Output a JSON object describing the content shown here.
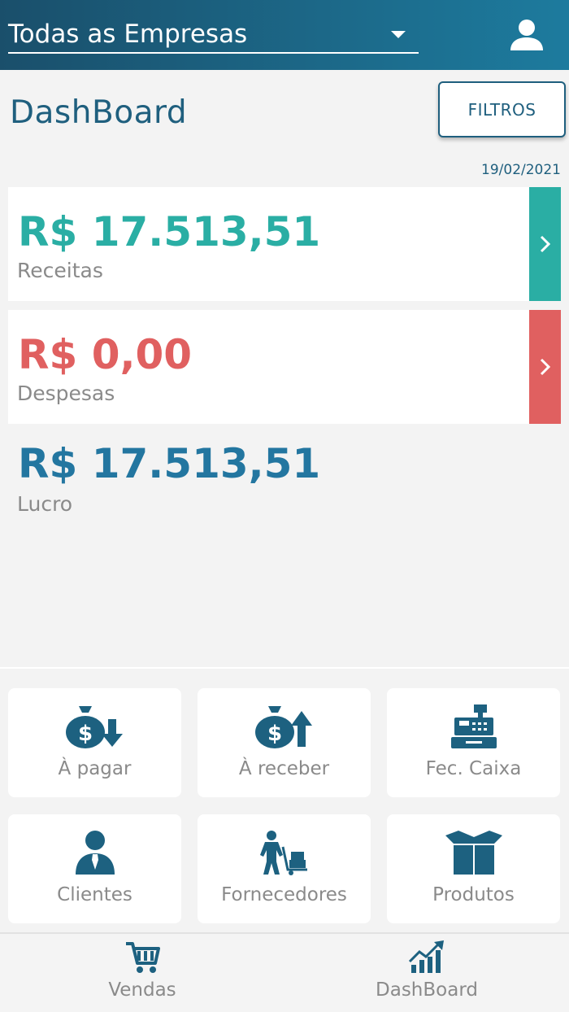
{
  "header": {
    "company_select": "Todas as Empresas",
    "user_icon": "user-icon"
  },
  "page": {
    "title": "DashBoard",
    "filter_label": "FILTROS",
    "date": "19/02/2021"
  },
  "summary": {
    "income": {
      "value": "R$ 17.513,51",
      "label": "Receitas",
      "color": "#2aaea4"
    },
    "expense": {
      "value": "R$ 0,00",
      "label": "Despesas",
      "color": "#e06060"
    },
    "profit": {
      "value": "R$ 17.513,51",
      "label": "Lucro",
      "color": "#2376a0"
    }
  },
  "shortcuts": [
    {
      "label": "À pagar",
      "icon": "money-bag-down-icon"
    },
    {
      "label": "À receber",
      "icon": "money-bag-up-icon"
    },
    {
      "label": "Fec. Caixa",
      "icon": "cash-register-icon"
    },
    {
      "label": "Clientes",
      "icon": "client-icon"
    },
    {
      "label": "Fornecedores",
      "icon": "supplier-icon"
    },
    {
      "label": "Produtos",
      "icon": "box-icon"
    }
  ],
  "bottom_nav": [
    {
      "label": "Vendas",
      "icon": "cart-icon"
    },
    {
      "label": "DashBoard",
      "icon": "chart-icon"
    }
  ],
  "colors": {
    "primary": "#1f5f7e",
    "income": "#2aaea4",
    "expense": "#e06060",
    "profit": "#2376a0"
  }
}
